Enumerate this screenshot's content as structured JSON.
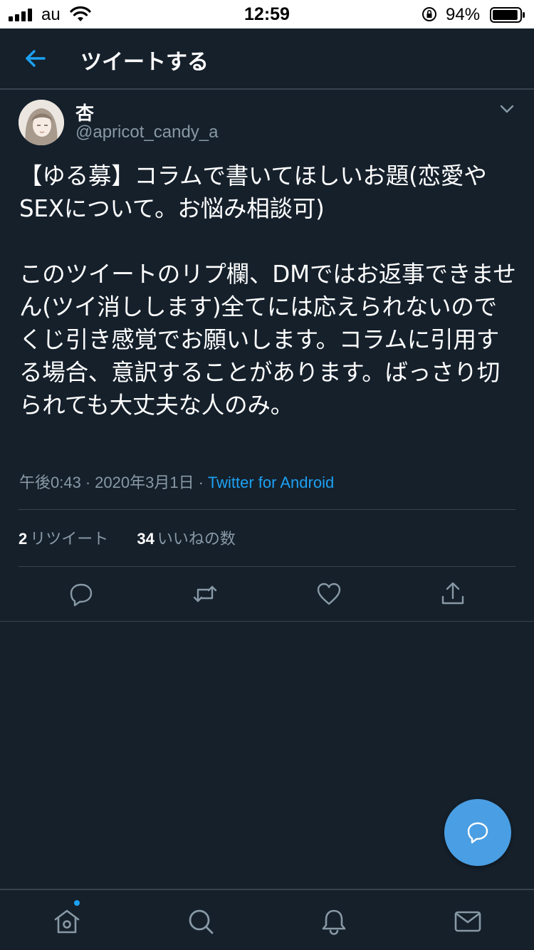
{
  "status_bar": {
    "carrier": "au",
    "time": "12:59",
    "battery_percent": "94%",
    "battery_level": 0.94
  },
  "header": {
    "title": "ツイートする",
    "back_icon": "arrow-left-icon"
  },
  "tweet": {
    "author_name": "杏",
    "author_handle": "@apricot_candy_a",
    "text": "【ゆる募】コラムで書いてほしいお題(恋愛やSEXについて。お悩み相談可)\n\nこのツイートのリプ欄、DMではお返事できません(ツイ消しします)全てには応えられないのでくじ引き感覚でお願いします。コラムに引用する場合、意訳することがあります。ばっさり切られても大丈夫な人のみ。",
    "time": "午後0:43",
    "date": "2020年3月1日",
    "separator": "·",
    "source": "Twitter for Android"
  },
  "stats": {
    "retweets_count": "2",
    "retweets_label": "リツイート",
    "likes_count": "34",
    "likes_label": "いいねの数"
  },
  "actions": [
    "reply-icon",
    "retweet-icon",
    "like-icon",
    "share-icon"
  ],
  "nav": [
    "home-icon",
    "search-icon",
    "notifications-icon",
    "messages-icon"
  ],
  "colors": {
    "background": "#15202b",
    "divider": "#38444d",
    "secondary_text": "#8899a6",
    "accent": "#1da1f2",
    "fab": "#4a9ee3"
  }
}
